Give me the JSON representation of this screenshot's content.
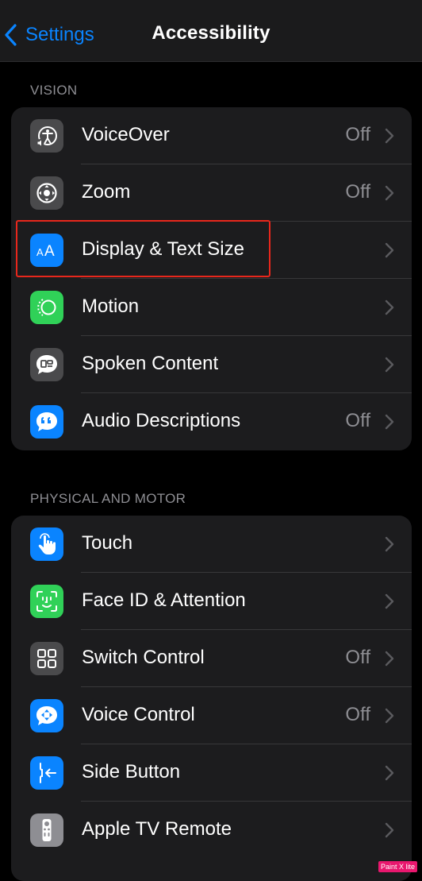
{
  "nav": {
    "back_label": "Settings",
    "title": "Accessibility"
  },
  "sections": [
    {
      "header": "VISION",
      "rows": [
        {
          "label": "VoiceOver",
          "value": "Off",
          "icon": "voiceover-icon",
          "color": "#4a4a4c"
        },
        {
          "label": "Zoom",
          "value": "Off",
          "icon": "zoom-icon",
          "color": "#4a4a4c"
        },
        {
          "label": "Display & Text Size",
          "value": "",
          "icon": "text-size-icon",
          "color": "#0a84ff"
        },
        {
          "label": "Motion",
          "value": "",
          "icon": "motion-icon",
          "color": "#30d158"
        },
        {
          "label": "Spoken Content",
          "value": "",
          "icon": "spoken-content-icon",
          "color": "#4a4a4c"
        },
        {
          "label": "Audio Descriptions",
          "value": "Off",
          "icon": "audio-descriptions-icon",
          "color": "#0a84ff"
        }
      ]
    },
    {
      "header": "PHYSICAL AND MOTOR",
      "rows": [
        {
          "label": "Touch",
          "value": "",
          "icon": "touch-icon",
          "color": "#0a84ff"
        },
        {
          "label": "Face ID & Attention",
          "value": "",
          "icon": "face-id-icon",
          "color": "#30d158"
        },
        {
          "label": "Switch Control",
          "value": "Off",
          "icon": "switch-control-icon",
          "color": "#4a4a4c"
        },
        {
          "label": "Voice Control",
          "value": "Off",
          "icon": "voice-control-icon",
          "color": "#0a84ff"
        },
        {
          "label": "Side Button",
          "value": "",
          "icon": "side-button-icon",
          "color": "#0a84ff"
        },
        {
          "label": "Apple TV Remote",
          "value": "",
          "icon": "tv-remote-icon",
          "color": "#8e8e93"
        }
      ]
    }
  ],
  "watermark": "Paint X lite",
  "colors": {
    "accent": "#0a84ff",
    "highlight": "#e8271c",
    "background": "#000000",
    "cell": "#1c1c1e"
  }
}
